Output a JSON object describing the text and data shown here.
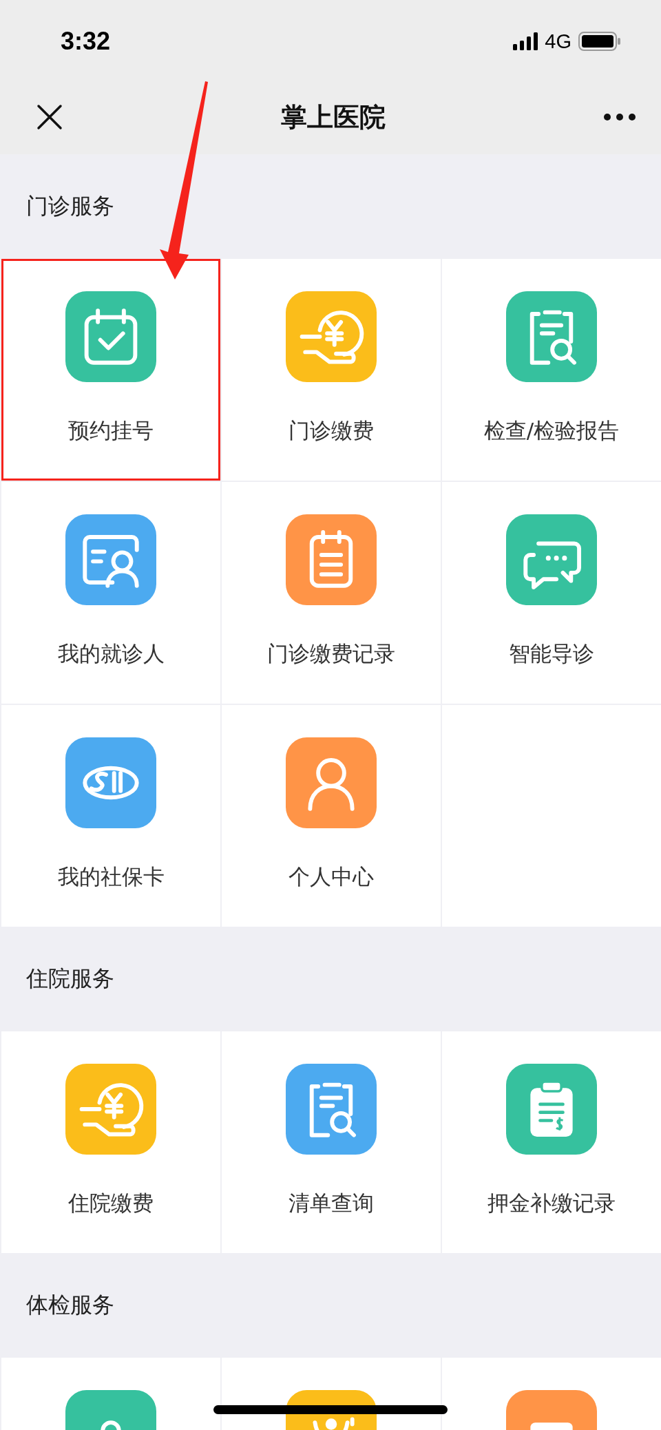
{
  "status_bar": {
    "time": "3:32",
    "network": "4G"
  },
  "nav_bar": {
    "title": "掌上医院"
  },
  "sections": [
    {
      "title": "门诊服务",
      "items": [
        {
          "label": "预约挂号",
          "kind": "calendar",
          "color": "#36c19e",
          "highlighted": true
        },
        {
          "label": "门诊缴费",
          "kind": "coin",
          "color": "#fbbd1a",
          "highlighted": false
        },
        {
          "label": "检查/检验报告",
          "kind": "report",
          "color": "#36c19e",
          "highlighted": false
        },
        {
          "label": "我的就诊人",
          "kind": "patient",
          "color": "#4caaf0",
          "highlighted": false
        },
        {
          "label": "门诊缴费记录",
          "kind": "notepad",
          "color": "#ff9447",
          "highlighted": false
        },
        {
          "label": "智能导诊",
          "kind": "chat",
          "color": "#36c19e",
          "highlighted": false
        },
        {
          "label": "我的社保卡",
          "kind": "si",
          "color": "#4caaf0",
          "highlighted": false
        },
        {
          "label": "个人中心",
          "kind": "person",
          "color": "#ff9447",
          "highlighted": false
        }
      ]
    },
    {
      "title": "住院服务",
      "items": [
        {
          "label": "住院缴费",
          "kind": "coin",
          "color": "#fbbd1a",
          "highlighted": false
        },
        {
          "label": "清单查询",
          "kind": "report",
          "color": "#4caaf0",
          "highlighted": false
        },
        {
          "label": "押金补缴记录",
          "kind": "clipboard",
          "color": "#36c19e",
          "highlighted": false
        }
      ]
    },
    {
      "title": "体检服务",
      "items": [
        {
          "kind": "pin",
          "color": "#36c19e",
          "highlighted": false
        },
        {
          "kind": "smile",
          "color": "#fbbd1a",
          "highlighted": false
        },
        {
          "kind": "card",
          "color": "#ff9447",
          "highlighted": false
        }
      ]
    }
  ]
}
